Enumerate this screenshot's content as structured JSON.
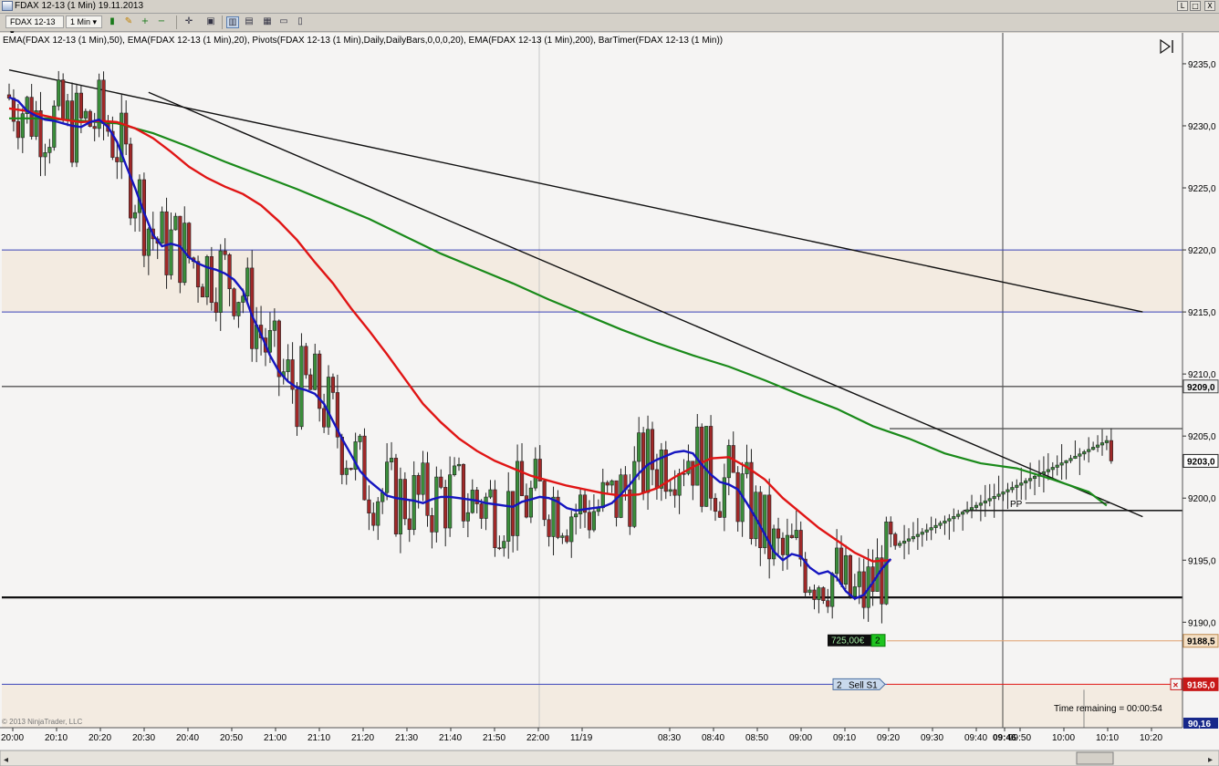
{
  "window": {
    "title": "FDAX 12-13 (1 Min)  19.11.2013",
    "buttons": [
      "L",
      "□",
      "X"
    ]
  },
  "toolbar": {
    "instrument": "FDAX 12-13",
    "interval": "1 Min",
    "icons": [
      "bar-style-icon",
      "draw-tool-icon",
      "zoom-in-icon",
      "zoom-out-icon",
      "crosshair-icon",
      "properties-icon",
      "chart-trader-icon",
      "data-box-icon",
      "workspace-icon",
      "window-linking-icon"
    ]
  },
  "indicators_label": "EMA(FDAX 12-13 (1 Min),50), EMA(FDAX 12-13 (1 Min),20), Pivots(FDAX 12-13 (1 Min),Daily,DailyBars,0,0,0,20), EMA(FDAX 12-13 (1 Min),200), BarTimer(FDAX 12-13 (1 Min))",
  "colors": {
    "up_candle": "#3a8d3a",
    "down_candle": "#a02828",
    "ema20": "#1515c0",
    "ema50": "#e01515",
    "ema200": "#1a8a1a",
    "zone_fill": "#f3ebe1",
    "pivot_line": "#3a44b8"
  },
  "chart_data": {
    "type": "candlestick",
    "instrument": "FDAX 12-13 (1 Min)",
    "ylim": [
      9181.5,
      9237.2
    ],
    "y_ticks": [
      "9235,0",
      "9230,0",
      "9225,0",
      "9220,0",
      "9215,0",
      "9210,0",
      "9205,0",
      "9200,0",
      "9195,0",
      "9190,0"
    ],
    "x_ticks": [
      "20:00",
      "20:10",
      "20:20",
      "20:30",
      "20:40",
      "20:50",
      "21:00",
      "21:10",
      "21:20",
      "21:30",
      "21:40",
      "21:50",
      "22:00",
      "11/19",
      "08:30",
      "08:40",
      "08:50",
      "09:00",
      "09:10",
      "09:20",
      "09:30",
      "09:40",
      "09:46",
      "09:50",
      "10:00",
      "10:10",
      "10:20"
    ],
    "ema20": [
      [
        0,
        9232.3
      ],
      [
        2,
        9232.0
      ],
      [
        4,
        9231.2
      ],
      [
        6,
        9230.8
      ],
      [
        8,
        9230.5
      ],
      [
        10,
        9230.4
      ],
      [
        12,
        9230.2
      ],
      [
        14,
        9230.0
      ],
      [
        16,
        9229.9
      ],
      [
        18,
        9230.3
      ],
      [
        20,
        9230.5
      ],
      [
        22,
        9229.9
      ],
      [
        24,
        9228.7
      ],
      [
        26,
        9226.8
      ],
      [
        28,
        9225.0
      ],
      [
        30,
        9223.0
      ],
      [
        32,
        9221.2
      ],
      [
        34,
        9220.3
      ],
      [
        36,
        9220.5
      ],
      [
        38,
        9220.3
      ],
      [
        40,
        9219.4
      ],
      [
        42,
        9218.9
      ],
      [
        44,
        9218.6
      ],
      [
        46,
        9218.4
      ],
      [
        48,
        9218.1
      ],
      [
        50,
        9217.6
      ],
      [
        52,
        9216.7
      ],
      [
        54,
        9214.7
      ],
      [
        56,
        9213.2
      ],
      [
        58,
        9211.5
      ],
      [
        60,
        9210.2
      ],
      [
        62,
        9209.4
      ],
      [
        64,
        9208.9
      ],
      [
        66,
        9208.7
      ],
      [
        68,
        9208.4
      ],
      [
        70,
        9207.6
      ],
      [
        72,
        9206.2
      ],
      [
        74,
        9204.8
      ],
      [
        76,
        9203.5
      ],
      [
        78,
        9202.2
      ],
      [
        80,
        9201.4
      ],
      [
        82,
        9200.8
      ],
      [
        84,
        9200.2
      ],
      [
        86,
        9200.0
      ],
      [
        88,
        9199.9
      ],
      [
        90,
        9199.8
      ],
      [
        92,
        9199.6
      ],
      [
        94,
        9199.9
      ],
      [
        96,
        9200.1
      ],
      [
        98,
        9200.1
      ],
      [
        100,
        9200.0
      ],
      [
        102,
        9199.9
      ],
      [
        104,
        9199.8
      ],
      [
        106,
        9199.6
      ],
      [
        108,
        9199.5
      ],
      [
        110,
        9199.4
      ],
      [
        112,
        9199.3
      ],
      [
        114,
        9199.7
      ],
      [
        116,
        9199.9
      ],
      [
        118,
        9200.1
      ],
      [
        120,
        9200.0
      ],
      [
        122,
        9199.7
      ],
      [
        124,
        9199.2
      ],
      [
        126,
        9199.0
      ],
      [
        128,
        9199.1
      ],
      [
        130,
        9199.2
      ],
      [
        132,
        9199.3
      ],
      [
        134,
        9199.6
      ],
      [
        136,
        9200.3
      ],
      [
        138,
        9201.1
      ],
      [
        140,
        9202.0
      ],
      [
        142,
        9202.7
      ],
      [
        144,
        9203.1
      ],
      [
        146,
        9203.4
      ],
      [
        148,
        9203.7
      ],
      [
        150,
        9203.8
      ],
      [
        152,
        9203.6
      ],
      [
        154,
        9202.7
      ],
      [
        156,
        9201.9
      ],
      [
        158,
        9201.3
      ],
      [
        160,
        9201.1
      ],
      [
        162,
        9200.7
      ],
      [
        164,
        9199.6
      ],
      [
        166,
        9198.4
      ],
      [
        168,
        9197.1
      ],
      [
        170,
        9195.7
      ],
      [
        172,
        9195.0
      ],
      [
        174,
        9195.5
      ],
      [
        176,
        9195.3
      ],
      [
        178,
        9194.4
      ],
      [
        180,
        9193.9
      ],
      [
        182,
        9194.1
      ],
      [
        184,
        9193.6
      ],
      [
        186,
        9192.5
      ],
      [
        188,
        9191.9
      ],
      [
        190,
        9192.2
      ],
      [
        192,
        9193.2
      ],
      [
        194,
        9194.3
      ],
      [
        196,
        9195.1
      ]
    ],
    "ema50": [
      [
        0,
        9231.4
      ],
      [
        4,
        9231.2
      ],
      [
        8,
        9230.8
      ],
      [
        12,
        9230.5
      ],
      [
        16,
        9230.3
      ],
      [
        20,
        9230.4
      ],
      [
        24,
        9230.3
      ],
      [
        28,
        9229.8
      ],
      [
        32,
        9229.0
      ],
      [
        36,
        9227.9
      ],
      [
        40,
        9226.7
      ],
      [
        44,
        9225.8
      ],
      [
        48,
        9225.1
      ],
      [
        52,
        9224.5
      ],
      [
        56,
        9223.6
      ],
      [
        60,
        9222.3
      ],
      [
        64,
        9220.8
      ],
      [
        68,
        9219.0
      ],
      [
        72,
        9217.3
      ],
      [
        76,
        9215.3
      ],
      [
        80,
        9213.5
      ],
      [
        84,
        9211.6
      ],
      [
        88,
        9209.6
      ],
      [
        92,
        9207.6
      ],
      [
        96,
        9206.1
      ],
      [
        100,
        9204.8
      ],
      [
        104,
        9203.8
      ],
      [
        108,
        9203.0
      ],
      [
        112,
        9202.4
      ],
      [
        116,
        9201.8
      ],
      [
        120,
        9201.4
      ],
      [
        124,
        9201.0
      ],
      [
        128,
        9200.7
      ],
      [
        132,
        9200.4
      ],
      [
        136,
        9200.2
      ],
      [
        140,
        9200.3
      ],
      [
        144,
        9200.8
      ],
      [
        148,
        9201.7
      ],
      [
        152,
        9202.5
      ],
      [
        156,
        9203.2
      ],
      [
        160,
        9203.3
      ],
      [
        164,
        9202.5
      ],
      [
        168,
        9201.5
      ],
      [
        172,
        9200.0
      ],
      [
        176,
        9198.8
      ],
      [
        180,
        9197.6
      ],
      [
        184,
        9196.6
      ],
      [
        188,
        9195.6
      ],
      [
        192,
        9194.9
      ],
      [
        196,
        9195.0
      ]
    ],
    "ema200": [
      [
        0,
        9230.6
      ],
      [
        8,
        9230.6
      ],
      [
        16,
        9230.4
      ],
      [
        24,
        9230.2
      ],
      [
        32,
        9229.4
      ],
      [
        40,
        9228.3
      ],
      [
        48,
        9227.1
      ],
      [
        56,
        9226.0
      ],
      [
        64,
        9224.9
      ],
      [
        72,
        9223.7
      ],
      [
        80,
        9222.5
      ],
      [
        88,
        9221.1
      ],
      [
        96,
        9219.7
      ],
      [
        104,
        9218.5
      ],
      [
        112,
        9217.3
      ],
      [
        120,
        9216.0
      ],
      [
        128,
        9214.8
      ],
      [
        136,
        9213.6
      ],
      [
        144,
        9212.5
      ],
      [
        152,
        9211.5
      ],
      [
        160,
        9210.6
      ],
      [
        168,
        9209.5
      ],
      [
        176,
        9208.3
      ],
      [
        184,
        9207.2
      ],
      [
        192,
        9205.8
      ],
      [
        200,
        9204.8
      ],
      [
        208,
        9203.6
      ],
      [
        216,
        9202.8
      ],
      [
        224,
        9202.4
      ],
      [
        232,
        9201.5
      ],
      [
        240,
        9200.5
      ],
      [
        244,
        9199.4
      ]
    ],
    "trendlines": [
      {
        "from": [
          0,
          9234.5
        ],
        "to": [
          252,
          9215.0
        ]
      },
      {
        "from": [
          31,
          9232.7
        ],
        "to": [
          252,
          9198.5
        ]
      }
    ],
    "horizontal_lines": [
      {
        "price": 9220.0,
        "style": "pivot"
      },
      {
        "price": 9215.0,
        "style": "pivot"
      },
      {
        "price": 9209.0,
        "style": "level"
      },
      {
        "price": 9205.6,
        "style": "level"
      },
      {
        "price": 9199.0,
        "style": "pp"
      },
      {
        "price": 9192.0,
        "style": "level-bold"
      },
      {
        "price": 9188.5,
        "style": "position"
      },
      {
        "price": 9185.0,
        "style": "order"
      }
    ],
    "labels": {
      "pp": "PP",
      "position_pnl": "725,00€",
      "position_qty": "2",
      "order_qty": "2",
      "order_type": "Sell S1",
      "bar_timer": "Time remaining = 00:00:54",
      "copyright": "© 2013 NinjaTrader, LLC"
    },
    "price_markers": [
      {
        "text": "9209,0",
        "price": 9209.0,
        "style": "plain"
      },
      {
        "text": "9203,0",
        "price": 9203.0,
        "style": "last"
      },
      {
        "text": "9188,5",
        "price": 9188.5,
        "style": "position"
      },
      {
        "text": "9185,0",
        "price": 9185.0,
        "style": "order"
      }
    ],
    "current_price": 9203.0,
    "bottom_marker": "90,16"
  }
}
